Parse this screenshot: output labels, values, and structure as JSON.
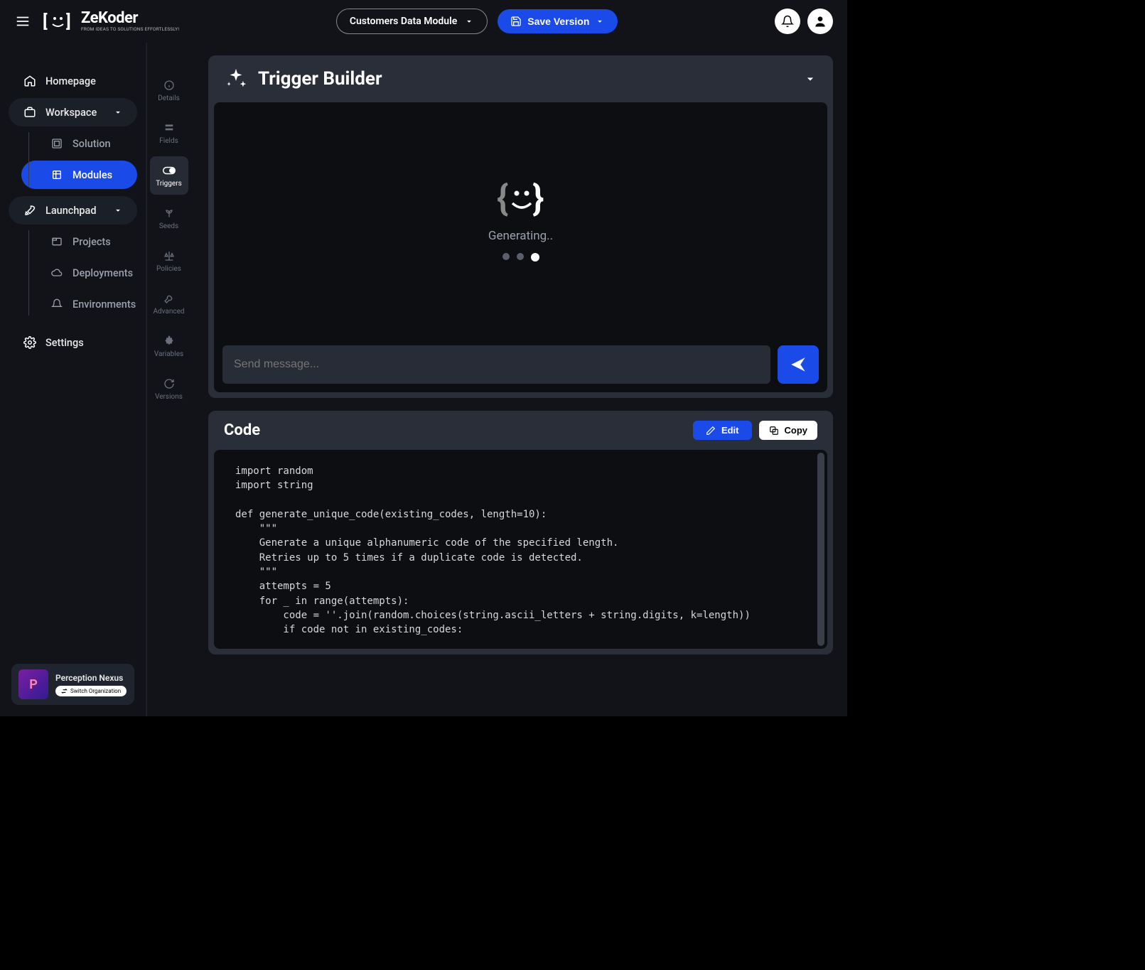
{
  "brand": {
    "title": "ZeKoder",
    "sub": "FROM IDEAS TO SOLUTIONS EFFORTLESSLY!"
  },
  "topbar": {
    "module_select": "Customers Data Module",
    "save_label": "Save Version"
  },
  "sidebar": {
    "homepage": "Homepage",
    "workspace": "Workspace",
    "solution": "Solution",
    "modules": "Modules",
    "launchpad": "Launchpad",
    "projects": "Projects",
    "deployments": "Deployments",
    "environments": "Environments",
    "settings": "Settings"
  },
  "org": {
    "name": "Perception Nexus",
    "switch_label": "Switch Organization"
  },
  "minibar": {
    "details": "Details",
    "fields": "Fields",
    "triggers": "Triggers",
    "seeds": "Seeds",
    "policies": "Policies",
    "advanced": "Advanced",
    "variables": "Variables",
    "versions": "Versions"
  },
  "trigger_panel": {
    "title": "Trigger Builder",
    "generating": "Generating..",
    "placeholder": "Send message..."
  },
  "code_panel": {
    "title": "Code",
    "edit": "Edit",
    "copy": "Copy",
    "code": "import random\nimport string\n\ndef generate_unique_code(existing_codes, length=10):\n    \"\"\"\n    Generate a unique alphanumeric code of the specified length.\n    Retries up to 5 times if a duplicate code is detected.\n    \"\"\"\n    attempts = 5\n    for _ in range(attempts):\n        code = ''.join(random.choices(string.ascii_letters + string.digits, k=length))\n        if code not in existing_codes:"
  }
}
